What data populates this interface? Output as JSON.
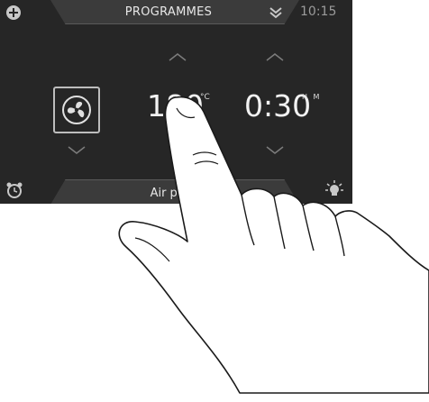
{
  "header": {
    "title": "PROGRAMMES",
    "time": "10:15"
  },
  "program": {
    "icon": "fan-icon"
  },
  "temperature": {
    "value": "180",
    "unit": "°C"
  },
  "duration": {
    "value": "0:30",
    "unit": "H M"
  },
  "footer": {
    "label": "Air pulsé"
  },
  "icons": {
    "top_left": "plus-circle-icon",
    "top_right": "double-chevron-down-icon",
    "bottom_left": "alarm-clock-icon",
    "bottom_right": "lamp-icon"
  }
}
